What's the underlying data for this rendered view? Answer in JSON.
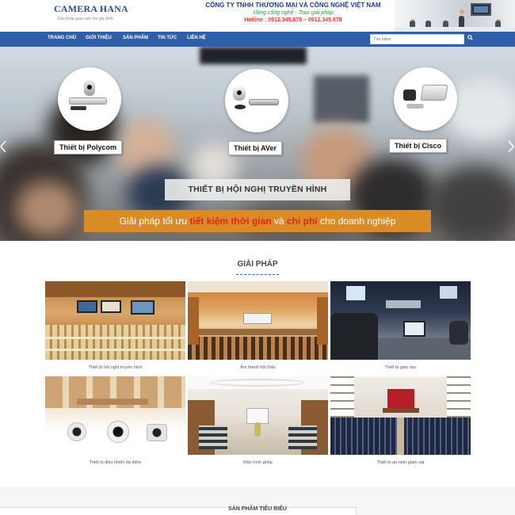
{
  "header": {
    "brand": "CAMERA HANA",
    "tagline": "Giải pháp quan sát cho gia đình",
    "company_name": "CÔNG TY TNHH THƯƠNG MẠI VÀ CÔNG NGHỆ VIỆT NAM",
    "slogan": "Vững công nghệ - Trao giải pháp",
    "hotline": "Hotline : 0912.345.678 – 0912.345.678"
  },
  "nav": {
    "items": [
      "TRANG CHỦ",
      "GIỚI THIỆU",
      "SẢN PHẨM",
      "TIN TỨC",
      "LIÊN HỆ"
    ],
    "search_placeholder": "Tìm kiếm",
    "search_icon": "search-icon"
  },
  "hero": {
    "devices": [
      "Thiết bị Polycom",
      "Thiết bị AVer",
      "Thiết bị Cisco"
    ],
    "title": "THIẾT BỊ HỘI NGHỊ TRUYỀN HÌNH",
    "subtitle_part1": "Giải pháp tối ưu ",
    "subtitle_highlight1": "tiết kiệm thời gian",
    "subtitle_part2": " và ",
    "subtitle_highlight2": "chi phí",
    "subtitle_part3": " cho doanh nghiệp",
    "prev_icon": "chevron-left-icon",
    "next_icon": "chevron-right-icon"
  },
  "solutions": {
    "title": "GIẢI PHÁP",
    "items": [
      "Thiết bị hội nghị truyền hình",
      "Âm thanh hội thảo",
      "Thiết bị giáo dục",
      "Thiết bị điều khiển đa điểm",
      "Màn hình ghép",
      "Thiết bị an ninh giám sát"
    ]
  },
  "footer": {
    "title": "SẢN PHẨM TIÊU BIỂU"
  },
  "colors": {
    "nav_bg": "#2f5fa9",
    "brand": "#2a4f8f",
    "subtitle_bg": "#d98c26",
    "highlight": "#e3241c"
  }
}
